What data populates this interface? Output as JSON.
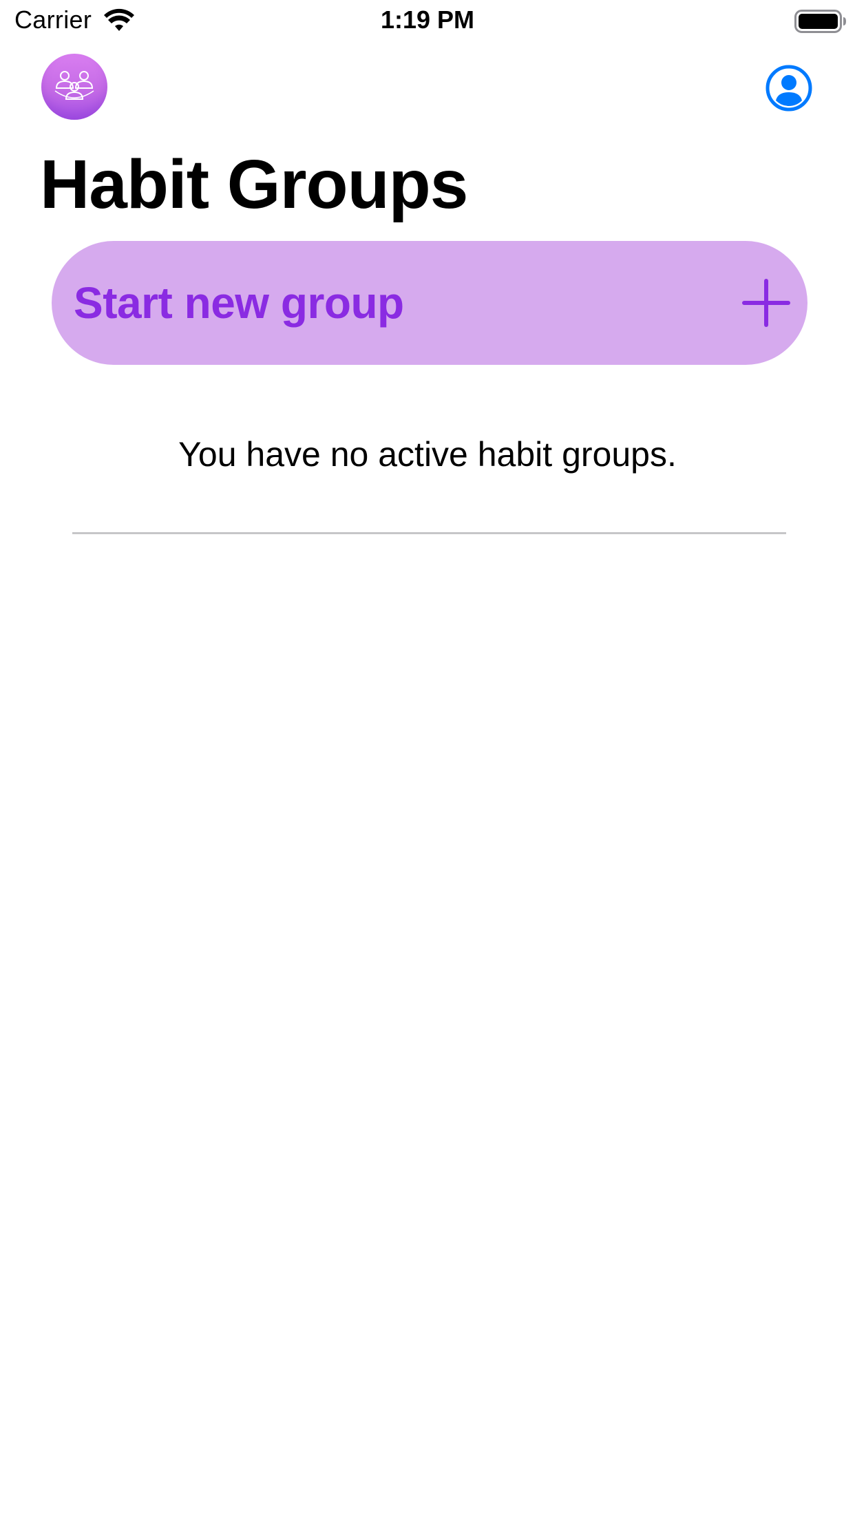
{
  "status_bar": {
    "carrier": "Carrier",
    "time": "1:19 PM",
    "icons": [
      "wifi-icon",
      "battery-icon"
    ]
  },
  "nav": {
    "logo_icon": "group-people-icon",
    "profile_icon": "person-circle-icon"
  },
  "page": {
    "title": "Habit Groups"
  },
  "start_group": {
    "label": "Start new group",
    "icon": "plus-icon"
  },
  "empty_state": {
    "message": "You have no active habit groups."
  },
  "colors": {
    "accent_purple": "#8a2be2",
    "button_fill": "#d6aaee",
    "logo_gradient_top": "#d97ef0",
    "logo_gradient_bottom": "#a653e6",
    "profile_blue": "#007aff",
    "divider": "#c6c6c8"
  }
}
